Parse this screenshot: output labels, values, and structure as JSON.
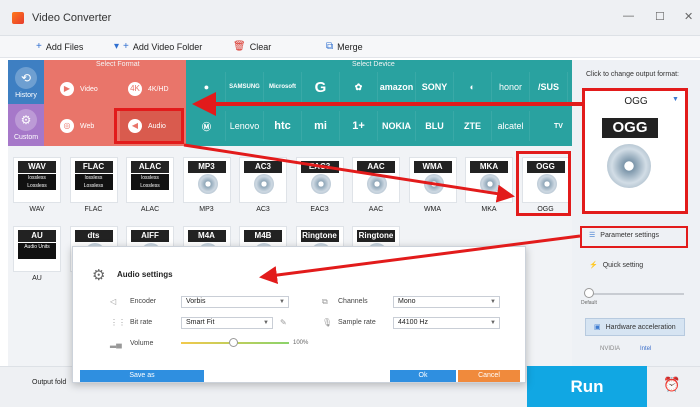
{
  "app": {
    "title": "Video Converter"
  },
  "window_controls": [
    "—",
    "☐",
    "✕"
  ],
  "toolbar": {
    "add_files": "Add Files",
    "add_video_folder": "Add Video Folder",
    "clear": "Clear",
    "merge": "Merge"
  },
  "left_tabs": [
    {
      "label": "History"
    },
    {
      "label": "Custom"
    }
  ],
  "select_format_label": "Select Format",
  "select_device_label": "Select Device",
  "format_categories": [
    "Video",
    "4K/HD",
    "Web",
    "Audio"
  ],
  "devices_row1": [
    "",
    "SAMSUNG",
    "Microsoft",
    "G",
    "",
    "amazon",
    "SONY",
    "",
    "honor",
    "/SUS"
  ],
  "devices_row2": [
    "",
    "Lenovo",
    "htc",
    "mi",
    "1+",
    "NOKIA",
    "BLU",
    "ZTE",
    "alcatel",
    "TV"
  ],
  "audio_formats_row1": [
    {
      "badge": "WAV",
      "sub": "lossless\nLossless\nAudio",
      "name": "WAV"
    },
    {
      "badge": "FLAC",
      "sub": "lossless\nLossless\nAudio",
      "name": "FLAC"
    },
    {
      "badge": "ALAC",
      "sub": "lossless\nLossless\nAudio",
      "name": "ALAC"
    },
    {
      "badge": "MP3",
      "sub": "",
      "name": "MP3"
    },
    {
      "badge": "AC3",
      "sub": "",
      "name": "AC3"
    },
    {
      "badge": "EAC3",
      "sub": "",
      "name": "EAC3"
    },
    {
      "badge": "AAC",
      "sub": "",
      "name": "AAC"
    },
    {
      "badge": "WMA",
      "sub": "",
      "name": "WMA"
    },
    {
      "badge": "MKA",
      "sub": "",
      "name": "MKA"
    },
    {
      "badge": "OGG",
      "sub": "",
      "name": "OGG"
    }
  ],
  "audio_formats_row2": [
    {
      "badge": "AU",
      "sub": "Audio Units",
      "name": "AU"
    },
    {
      "badge": "dts",
      "sub": "",
      "name": ""
    },
    {
      "badge": "AIFF",
      "sub": "",
      "name": ""
    },
    {
      "badge": "M4A",
      "sub": "",
      "name": ""
    },
    {
      "badge": "M4B",
      "sub": "",
      "name": ""
    },
    {
      "badge": "Ringtone",
      "sub": "",
      "name": ""
    },
    {
      "badge": "Ringtone",
      "sub": "",
      "name": ""
    }
  ],
  "output": {
    "change_label": "Click to change output format:",
    "format": "OGG",
    "icon_label": "OGG"
  },
  "side": {
    "parameter_settings": "Parameter settings",
    "quick_setting": "Quick setting",
    "default_label": "Default",
    "hardware_acceleration": "Hardware acceleration",
    "nvidia": "NVIDIA",
    "intel": "Intel"
  },
  "dialog": {
    "title": "Audio settings",
    "encoder_label": "Encoder",
    "encoder_value": "Vorbis",
    "channels_label": "Channels",
    "channels_value": "Mono",
    "bitrate_label": "Bit rate",
    "bitrate_value": "Smart Fit",
    "samplerate_label": "Sample rate",
    "samplerate_value": "44100 Hz",
    "volume_label": "Volume",
    "volume_value": "100%",
    "volume_level": 0.5,
    "save_as": "Save as",
    "ok": "Ok",
    "cancel": "Cancel"
  },
  "bottom": {
    "output_folder": "Output fold",
    "run": "Run"
  },
  "colors": {
    "format_panel": "#e9756a",
    "device_panel": "#29a2a0",
    "highlight": "#e21b1b",
    "run": "#11a7e3",
    "ok": "#2f8fe0",
    "cancel": "#f08a3c"
  }
}
